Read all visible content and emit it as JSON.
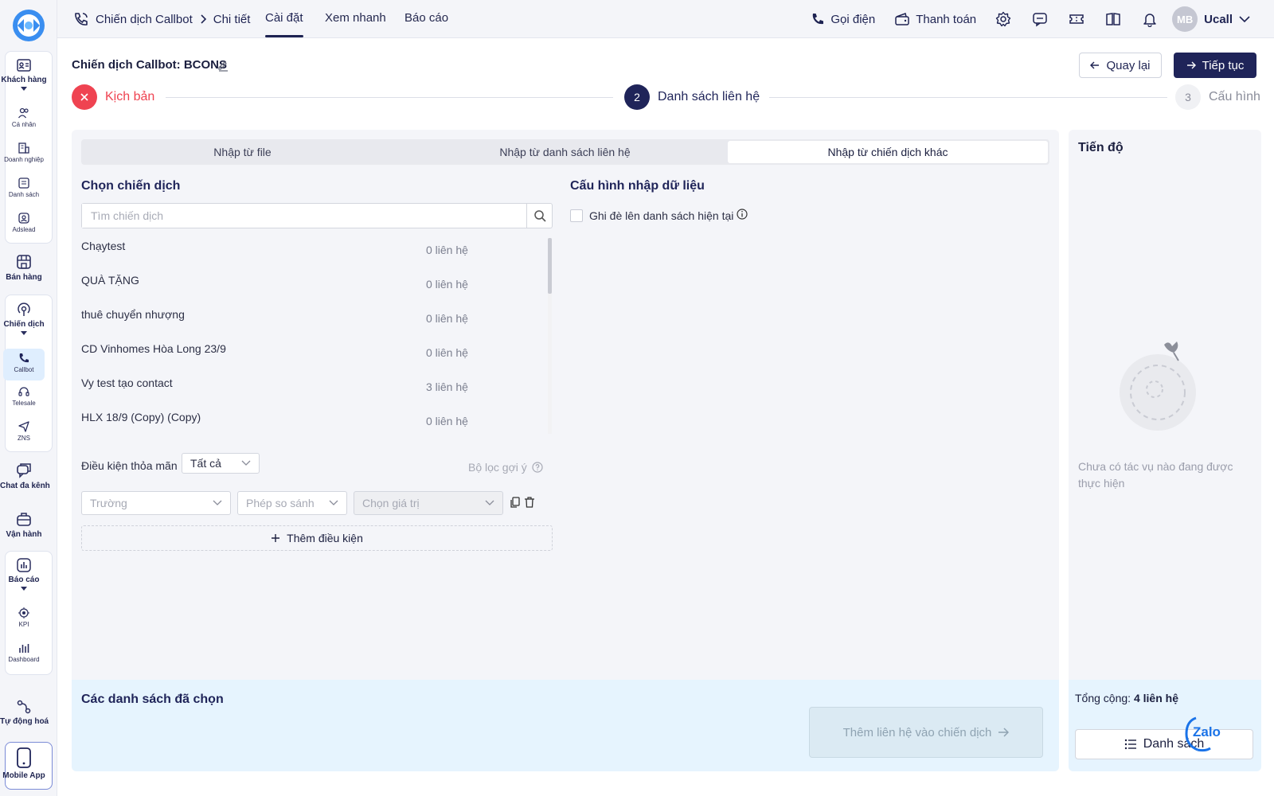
{
  "sidebar": {
    "customers": {
      "label": "Khách hàng",
      "items": [
        "Cá nhân",
        "Doanh nghiệp",
        "Danh sách",
        "Adslead"
      ]
    },
    "sales": {
      "label": "Bán hàng"
    },
    "campaigns": {
      "label": "Chiến dịch",
      "items": [
        "Callbot",
        "Telesale",
        "ZNS"
      ]
    },
    "chat": {
      "label": "Chat đa kênh"
    },
    "operations": {
      "label": "Vận hành"
    },
    "reports": {
      "label": "Báo cáo",
      "items": [
        "KPI",
        "Dashboard"
      ]
    },
    "automation": {
      "label": "Tự động hoá"
    },
    "mobile": {
      "label": "Mobile App"
    }
  },
  "topbar": {
    "breadcrumb": [
      "Chiến dịch Callbot",
      "Chi tiết"
    ],
    "tabs": [
      "Cài đặt",
      "Xem nhanh",
      "Báo cáo"
    ],
    "active_tab": "Cài đặt",
    "call_label": "Gọi điện",
    "payment_label": "Thanh toán",
    "avatar_initials": "MB",
    "user_name": "Ucall"
  },
  "header": {
    "title": "Chiến dịch Callbot: BCONS",
    "back_label": "Quay lại",
    "next_label": "Tiếp tục"
  },
  "steps": [
    {
      "number": "",
      "label": "Kịch bản",
      "status": "error"
    },
    {
      "number": "2",
      "label": "Danh sách liên hệ",
      "status": "active"
    },
    {
      "number": "3",
      "label": "Cấu hình",
      "status": "pending"
    }
  ],
  "import_tabs": [
    "Nhập từ file",
    "Nhập từ danh sách liên hệ",
    "Nhập từ chiến dịch khác"
  ],
  "active_import_tab": "Nhập từ chiến dịch khác",
  "choose_campaign": {
    "title": "Chọn chiến dịch",
    "search_placeholder": "Tìm chiến dịch",
    "campaigns": [
      {
        "name": "Chạytest",
        "count": "0 liên hệ"
      },
      {
        "name": "QUÀ TẶNG",
        "count": "0 liên hệ"
      },
      {
        "name": "thuê chuyển nhượng",
        "count": "0 liên hệ"
      },
      {
        "name": "CD Vinhomes Hòa Long 23/9",
        "count": "0 liên hệ"
      },
      {
        "name": "Vy test tạo contact",
        "count": "3 liên hệ"
      },
      {
        "name": "HLX 18/9 (Copy) (Copy)",
        "count": "0 liên hệ"
      }
    ]
  },
  "conditions": {
    "label": "Điều kiện thỏa mãn",
    "match_value": "Tất cả",
    "hint": "Bộ lọc gợi ý",
    "field_placeholder": "Trường",
    "operator_placeholder": "Phép so sánh",
    "value_placeholder": "Chọn giá trị",
    "add_label": "Thêm điều kiện"
  },
  "import_config": {
    "title": "Cấu hình nhập dữ liệu",
    "overwrite_label": "Ghi đè lên danh sách hiện tại",
    "overwrite_checked": false
  },
  "selected_lists": {
    "title": "Các danh sách đã chọn",
    "add_button": "Thêm liên hệ vào chiến dịch"
  },
  "progress": {
    "title": "Tiến độ",
    "empty_text": "Chưa có tác vụ nào đang được thực hiện",
    "total_label": "Tổng cộng:",
    "total_value": "4 liên hệ",
    "list_button": "Danh sách"
  },
  "widget": {
    "label": "Zalo"
  },
  "colors": {
    "primary": "#1f2459",
    "error": "#ef4351",
    "accent_bg": "#e6f4fe"
  }
}
